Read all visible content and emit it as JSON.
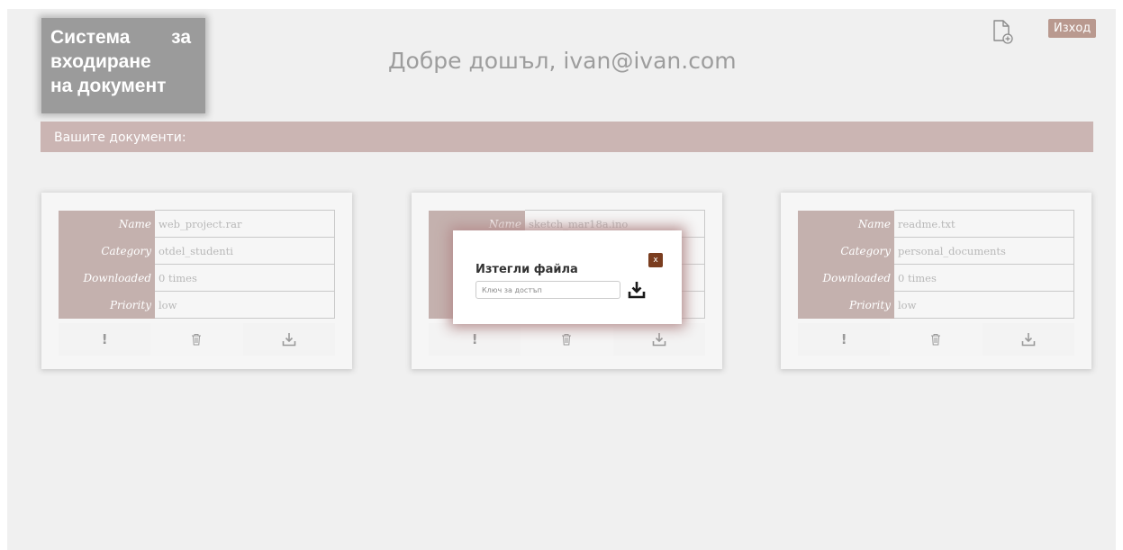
{
  "header": {
    "logo_line1_word1": "Система",
    "logo_line1_word2": "за",
    "logo_line2": "входиране",
    "logo_line3": "на документ",
    "welcome": "Добре дошъл, ivan@ivan.com",
    "logout_label": "Изход",
    "add_icon": "file-add-icon"
  },
  "section_title": "Вашите документи:",
  "labels": {
    "name": "Name",
    "category": "Category",
    "downloaded": "Downloaded",
    "priority": "Priority"
  },
  "cards": [
    {
      "name": "web_project.rar",
      "category": "otdel_studenti",
      "downloaded": "0 times",
      "priority": "low"
    },
    {
      "name": "sketch_mar18a.ino",
      "category": "",
      "downloaded": "",
      "priority": ""
    },
    {
      "name": "readme.txt",
      "category": "personal_documents",
      "downloaded": "0 times",
      "priority": "low"
    }
  ],
  "actions": {
    "priority_symbol": "!",
    "icons": [
      "exclamation-icon",
      "trash-icon",
      "download-icon"
    ]
  },
  "modal": {
    "title": "Изтегли файла",
    "close_label": "x",
    "input_placeholder": "Ключ за достъп",
    "input_value": ""
  },
  "colors": {
    "accent": "#cbb5b3",
    "label_bg": "#c4b1ae",
    "logout_bg": "#b9998f",
    "close_bg": "#7a3d1f",
    "logo_bg": "#9b9b9b"
  }
}
